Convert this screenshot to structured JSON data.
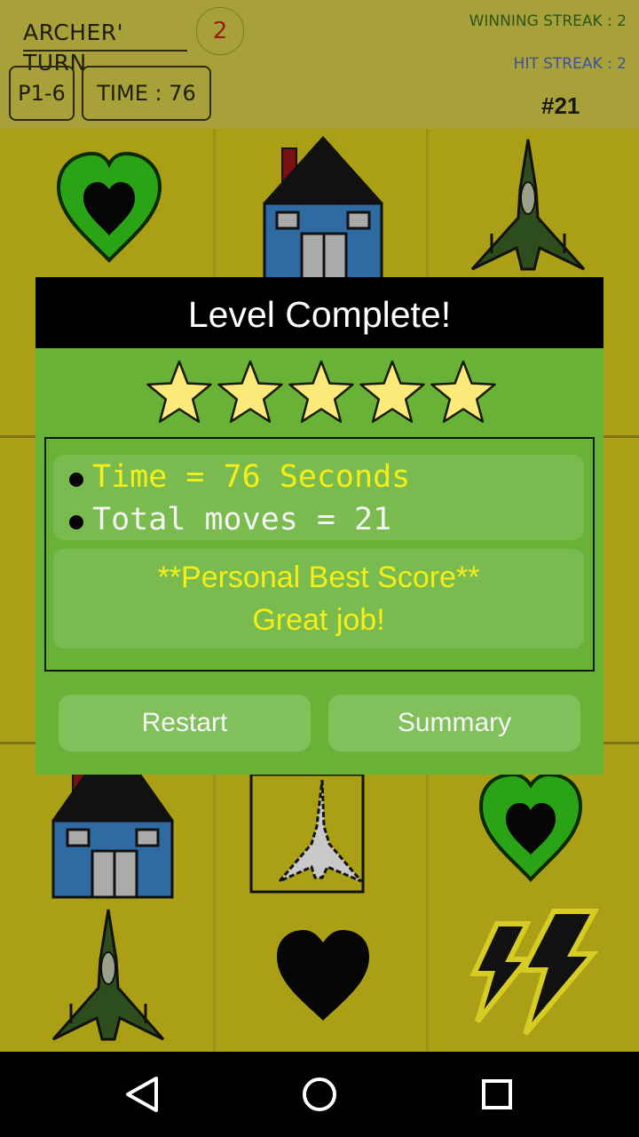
{
  "header": {
    "turn_label": "ARCHER' TURN",
    "turn_count": "2",
    "level": "P1-6",
    "time": "TIME : 76",
    "winning_streak": "WINNING STREAK : 2",
    "hit_streak": "HIT STREAK : 2",
    "move_number": "#21"
  },
  "dialog": {
    "title": "Level Complete!",
    "stars_earned": 5,
    "stars_total": 5,
    "time_stat": "Time = 76 Seconds",
    "moves_stat": "Total moves = 21",
    "best_score": "**Personal Best Score**",
    "praise": "Great job!",
    "restart_label": "Restart",
    "summary_label": "Summary"
  },
  "board": {
    "tiles": [
      "heart-green",
      "house",
      "jet",
      "house",
      "jet-outline",
      "heart-green",
      "jet",
      "heart-black",
      "lightning"
    ]
  },
  "colors": {
    "header_bg": "#a8a13a",
    "board_bg": "#aa9f15",
    "dialog_bg": "#67b237",
    "stat_yellow": "#f5ef17",
    "star": "#fbea7a"
  },
  "navbar": {
    "icons": [
      "back-icon",
      "home-icon",
      "recents-icon"
    ]
  }
}
